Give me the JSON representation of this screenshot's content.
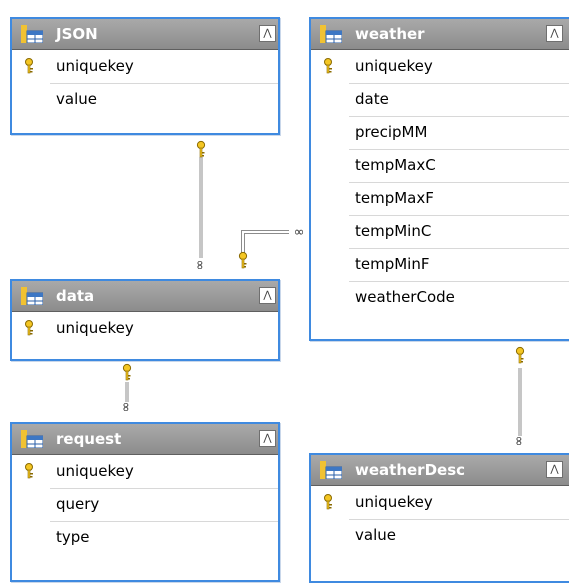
{
  "tables": {
    "json": {
      "title": "JSON",
      "columns": [
        "uniquekey",
        "value"
      ]
    },
    "weather": {
      "title": "weather",
      "columns": [
        "uniquekey",
        "date",
        "precipMM",
        "tempMaxC",
        "tempMaxF",
        "tempMinC",
        "tempMinF",
        "weatherCode"
      ]
    },
    "data": {
      "title": "data",
      "columns": [
        "uniquekey"
      ]
    },
    "request": {
      "title": "request",
      "columns": [
        "uniquekey",
        "query",
        "type"
      ]
    },
    "weatherDesc": {
      "title": "weatherDesc",
      "columns": [
        "uniquekey",
        "value"
      ]
    }
  },
  "primary_key_column": "uniquekey",
  "icons": {
    "table": "table-icon",
    "key": "key-icon",
    "collapse": "collapse-icon",
    "one_end": "key-icon",
    "many_end": "infinity-icon"
  },
  "colors": {
    "table_border": "#3f8ae0",
    "title_bar": "#9b9b9b",
    "key": "#e6b800"
  },
  "relationships": [
    {
      "from": "JSON",
      "to": "data",
      "one": "JSON",
      "many": "data"
    },
    {
      "from": "data",
      "to": "weather",
      "one": "data",
      "many": "weather"
    },
    {
      "from": "data",
      "to": "request",
      "one": "data",
      "many": "request"
    },
    {
      "from": "weather",
      "to": "weatherDesc",
      "one": "weather",
      "many": "weatherDesc"
    }
  ],
  "symbols": {
    "many": "∞",
    "collapse": "⋀"
  }
}
